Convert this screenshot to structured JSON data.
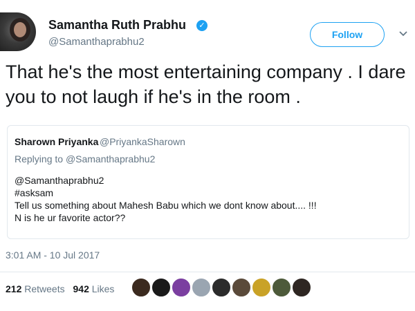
{
  "author": {
    "name": "Samantha Ruth Prabhu",
    "handle": "@Samanthaprabhu2",
    "verified": true
  },
  "follow_label": "Follow",
  "tweet_text": "That he's the most entertaining company . I dare you to not laugh if he's in the room .",
  "quoted_tweet": {
    "name": "Sharown Priyanka",
    "handle": "@PriyankaSharown",
    "replying_label": "Replying to",
    "replying_to": "@Samanthaprabhu2",
    "lines": [
      "@Samanthaprabhu2",
      "#asksam",
      "Tell us something about Mahesh Babu which we dont know about.... !!!",
      "N is he ur favorite actor??"
    ]
  },
  "timestamp": "3:01 AM - 10 Jul 2017",
  "stats": {
    "retweets_count": "212",
    "retweets_label": "Retweets",
    "likes_count": "942",
    "likes_label": "Likes"
  },
  "colors": {
    "accent": "#1da1f2",
    "text": "#14171a",
    "muted": "#657786",
    "border": "#e1e8ed"
  },
  "liker_avatars": [
    "#3b2a1f",
    "#1a1a1a",
    "#7b3fa0",
    "#9aa5b1",
    "#2b2b2b",
    "#5a4a3a",
    "#c9a227",
    "#4d5a3a",
    "#2e2622"
  ]
}
